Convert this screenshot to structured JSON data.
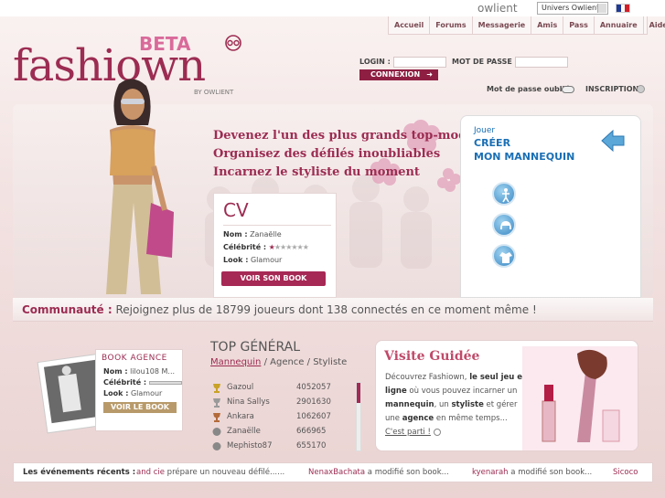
{
  "topbar": {
    "owlient_logo": "owlient",
    "univers_select": "Univers Owlient",
    "flag_colors": [
      "#1f3a93",
      "#ffffff",
      "#d0202a"
    ]
  },
  "nav": {
    "items": [
      "Accueil",
      "Forums",
      "Messagerie",
      "Amis",
      "Pass",
      "Annuaire",
      "Aide"
    ]
  },
  "logo": {
    "main": "fashiown",
    "beta": "BETA",
    "sub": "BY OWLIENT"
  },
  "login": {
    "login_label": "LOGIN :",
    "password_label": "MOT DE PASSE :",
    "connect_button": "CONNEXION",
    "connect_arrow": "➜",
    "forgot_label": "Mot de passe oublié",
    "signup_label": "INSCRIPTION"
  },
  "hero": {
    "slogans": [
      "Devenez l'un des plus grands top-models",
      "Organisez des défilés inoubliables",
      "Incarnez le styliste du moment"
    ],
    "cv": {
      "title": "CV",
      "name_label": "Nom :",
      "name_value": "Zanaëlle",
      "celebrity_label": "Célébrité :",
      "celebrity_stars": 1,
      "celebrity_max": 7,
      "look_label": "Look :",
      "look_value": "Glamour",
      "book_button": "VOIR SON BOOK"
    },
    "play": {
      "jouer": "Jouer",
      "create_line1": "CRÉER",
      "create_line2": "MON MANNEQUIN"
    }
  },
  "community": {
    "label": "Communauté :",
    "text": "Rejoignez plus de 18799 joueurs dont 138 connectés en ce moment même !"
  },
  "book_agence": {
    "title": "BOOK AGENCE",
    "name_label": "Nom :",
    "name_value": "lilou108 M...",
    "celebrity_label": "Célébrité :",
    "look_label": "Look :",
    "look_value": "Glamour",
    "button": "VOIR LE BOOK"
  },
  "top_general": {
    "title": "TOP GÉNÉRAL",
    "tabs": [
      "Mannequin",
      "Agence",
      "Styliste"
    ],
    "separator": " / ",
    "rows": [
      {
        "name": "Gazoul",
        "score": "4052057",
        "icon": "gold-trophy-icon"
      },
      {
        "name": "Nina Sallys",
        "score": "2901630",
        "icon": "silver-trophy-icon"
      },
      {
        "name": "Ankara",
        "score": "1062607",
        "icon": "bronze-trophy-icon"
      },
      {
        "name": "Zanaëlle",
        "score": "666965",
        "icon": "badge-icon"
      },
      {
        "name": "Mephisto87",
        "score": "655170",
        "icon": "badge-icon"
      }
    ]
  },
  "visite": {
    "title": "Visite Guidée",
    "text_parts": [
      {
        "t": "Découvrez Fashiown, ",
        "b": false
      },
      {
        "t": "le seul jeu en ligne",
        "b": true
      },
      {
        "t": " où vous pouvez incarner un ",
        "b": false
      },
      {
        "t": "mannequin",
        "b": true
      },
      {
        "t": ", un ",
        "b": false
      },
      {
        "t": "styliste",
        "b": true
      },
      {
        "t": " et gérer une ",
        "b": false
      },
      {
        "t": "agence",
        "b": true
      },
      {
        "t": " en même temps...",
        "b": false
      }
    ],
    "link": "C'est parti !"
  },
  "events": {
    "label": "Les événements récents :",
    "items": [
      {
        "name": "and cie",
        "action": "prépare un nouveau défilé......"
      },
      {
        "name": "NenaxBachata",
        "action": "a modifié son book..."
      },
      {
        "name": "kyenarah",
        "action": "a modifié son book..."
      },
      {
        "name": "Sicoco",
        "action": ""
      }
    ]
  },
  "colors": {
    "brand": "#9c2c52",
    "accent_blue": "#1a6fb5",
    "button_pink": "#a62854"
  }
}
